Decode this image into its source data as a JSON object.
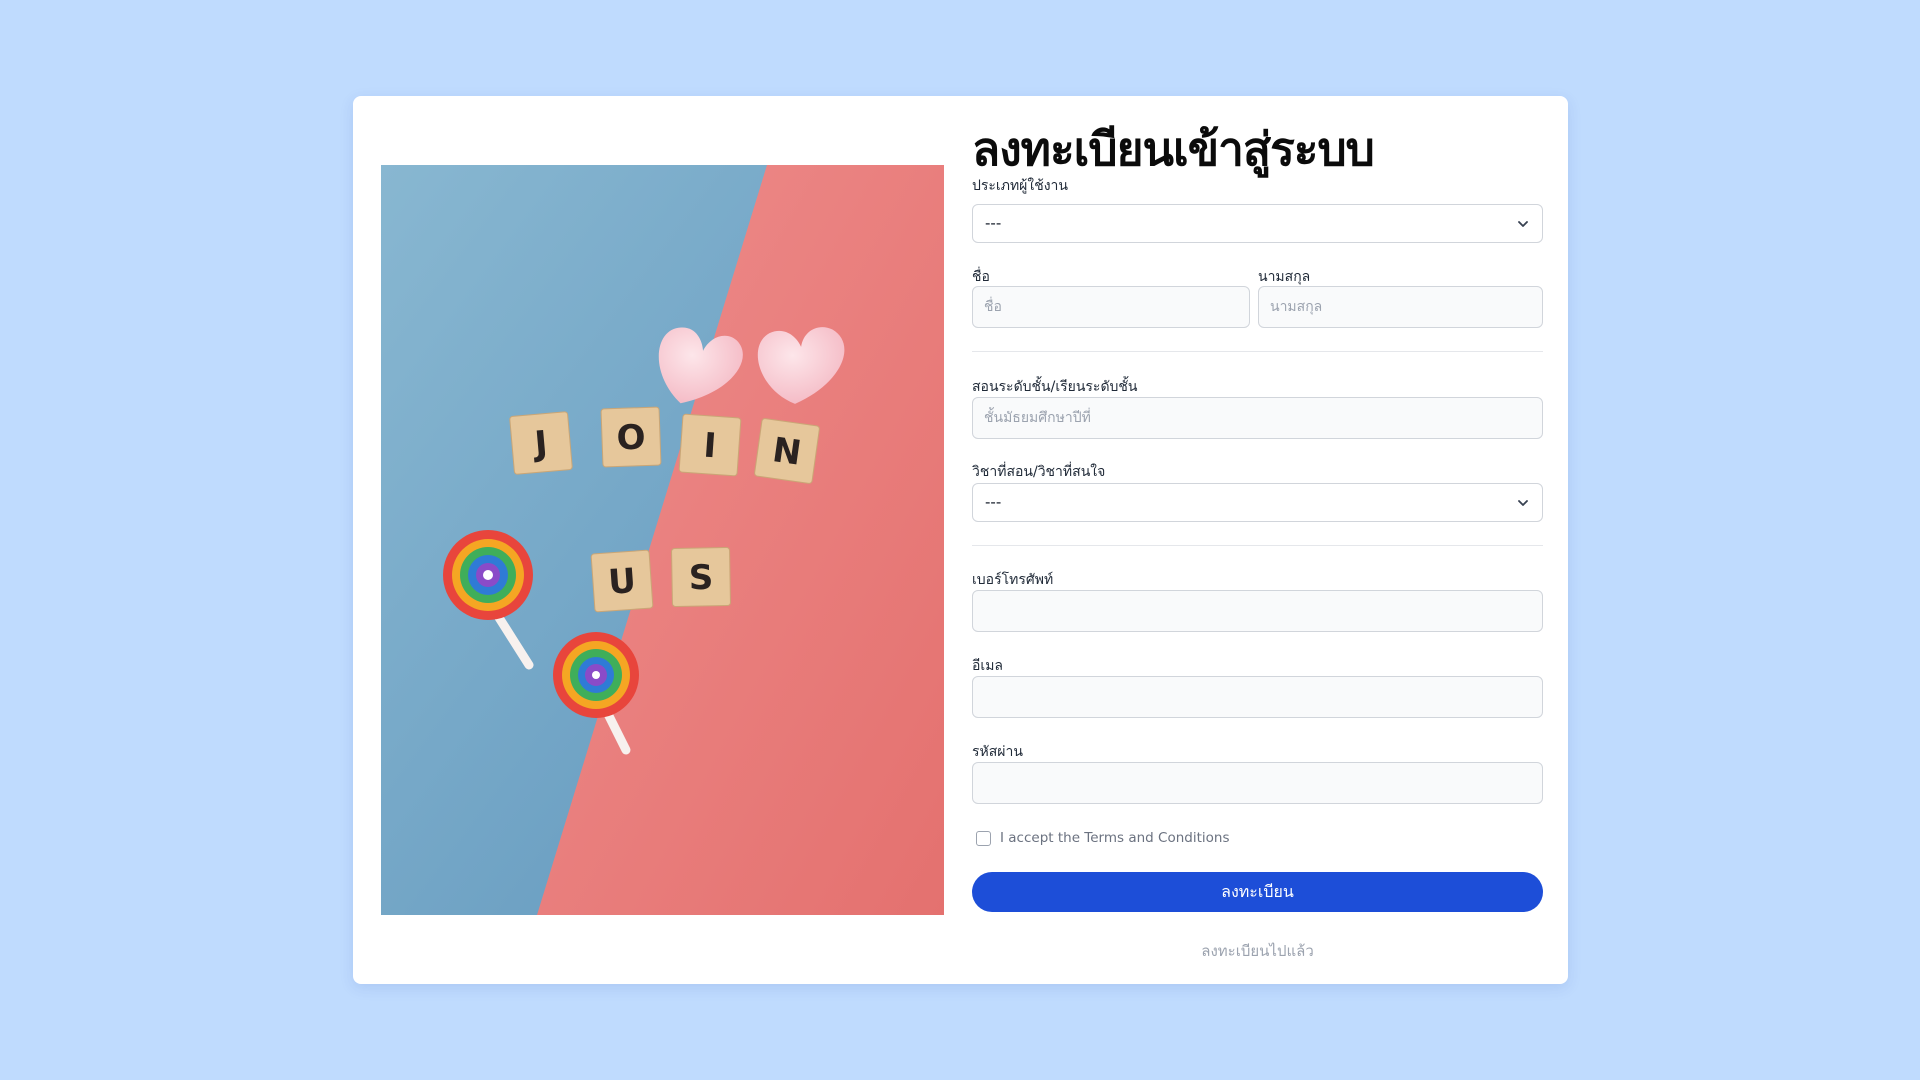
{
  "form": {
    "title": "ลงทะเบียนเข้าสู่ระบบ",
    "user_type_label": "ประเภทผู้ใช้งาน",
    "user_type_value": "---",
    "first_name_label": "ชื่อ",
    "first_name_placeholder": "ชื่อ",
    "last_name_label": "นามสกุล",
    "last_name_placeholder": "นามสกุล",
    "grade_label": "สอนระดับชั้น/เรียนระดับชั้น",
    "grade_placeholder": "ชั้นมัธยมศึกษาปีที่",
    "subject_label": "วิชาที่สอน/วิชาที่สนใจ",
    "subject_value": "---",
    "phone_label": "เบอร์โทรศัพท์",
    "email_label": "อีเมล",
    "password_label": "รหัสผ่าน",
    "terms_text": "I accept the Terms and Conditions",
    "submit_label": "ลงทะเบียน",
    "login_link": "ลงทะเบียนไปแล้ว"
  },
  "photo": {
    "tiles_row1": [
      "J",
      "O",
      "I",
      "N"
    ],
    "tiles_row2": [
      "U",
      "S"
    ]
  },
  "colors": {
    "page_background": "#bfdbfe",
    "primary_button": "#1d4ed8",
    "photo_blue": "#6fa3c4",
    "photo_pink": "#ec8583"
  },
  "icons": {
    "select_arrow": "chevron-down-icon"
  }
}
